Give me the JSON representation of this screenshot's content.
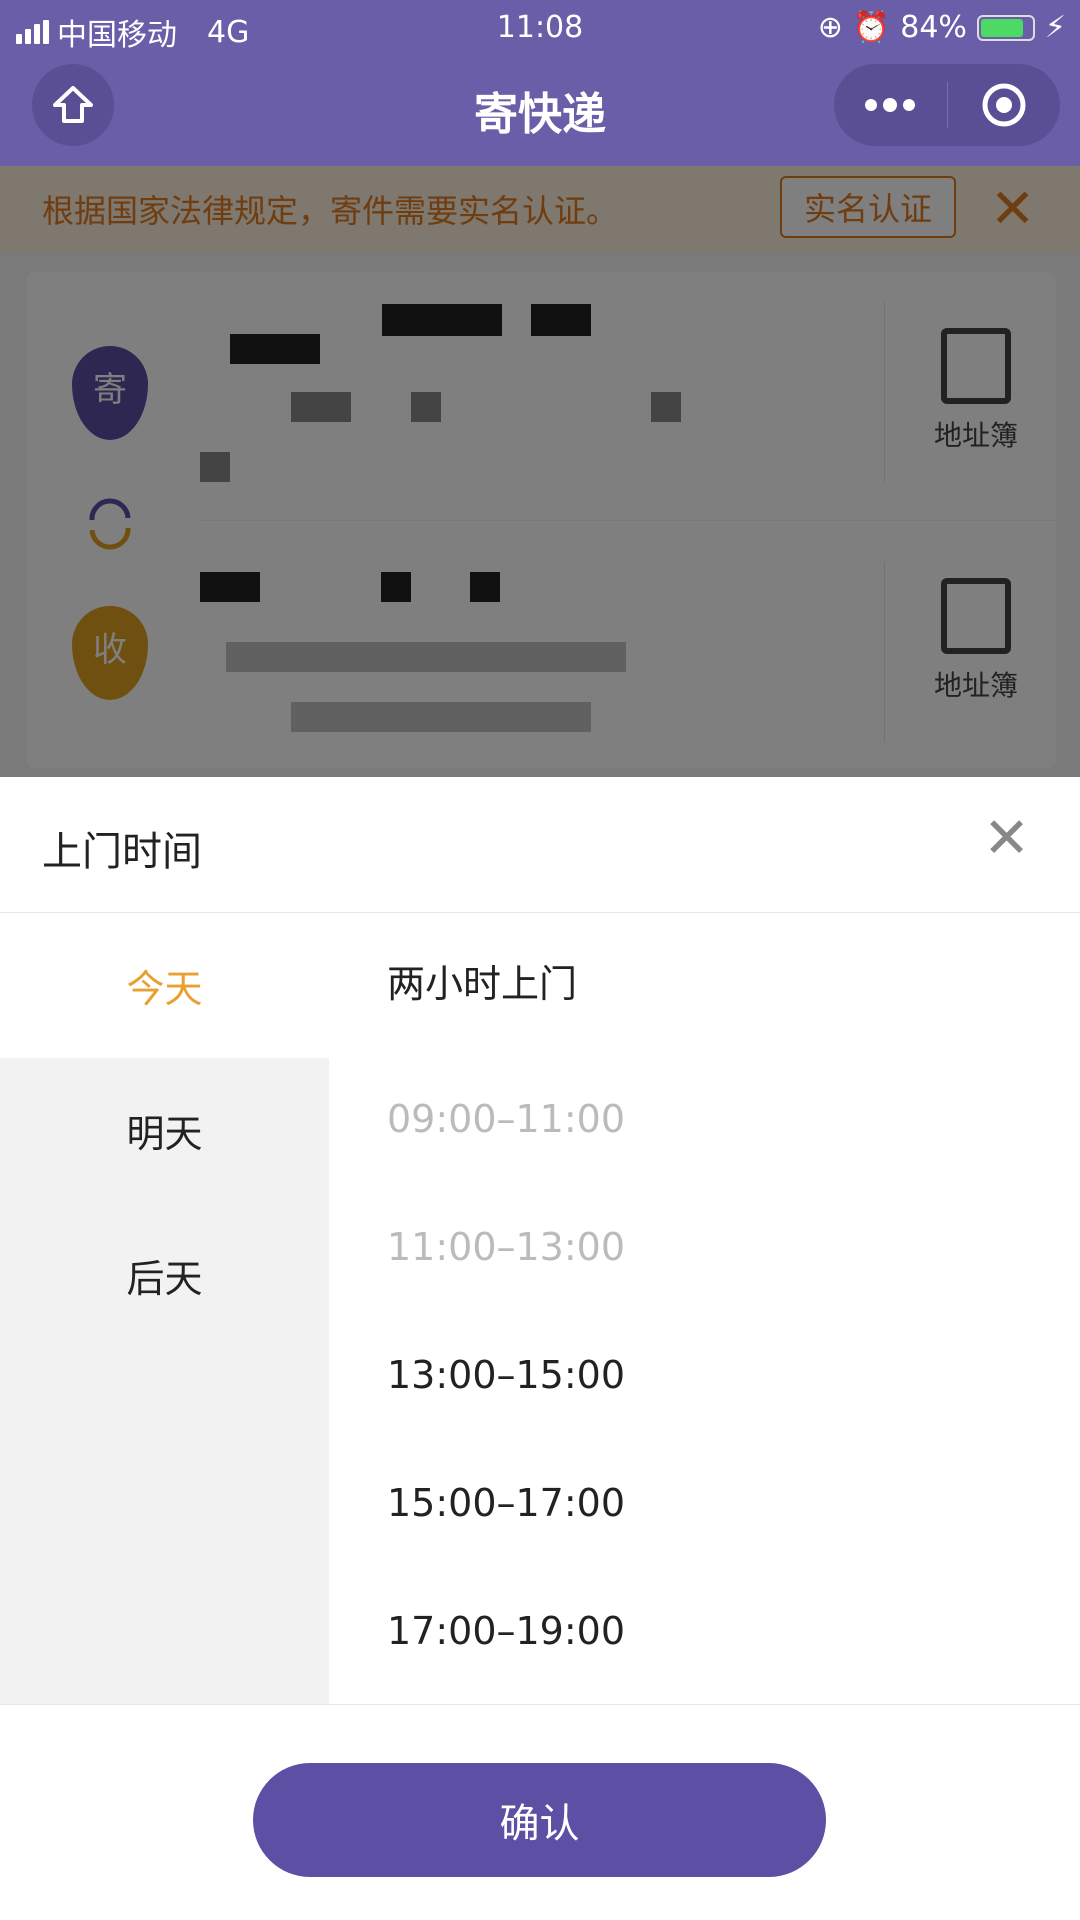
{
  "status_bar": {
    "carrier": "中国移动",
    "network": "4G",
    "time": "11:08",
    "battery": "84%",
    "battery_level": 0.84
  },
  "nav": {
    "title": "寄快递",
    "home_icon": "home-icon",
    "more_icon": "more-dots-icon",
    "close_icon": "target-circle-icon",
    "color": "#6b5ea8"
  },
  "notice": {
    "text": "根据国家法律规定，寄件需要实名认证。",
    "button": "实名认证",
    "close": "✕",
    "color": "#e07a20"
  },
  "address_card": {
    "sender_badge": "寄",
    "receiver_badge": "收",
    "address_book": "地址簿",
    "sender_color": "#5d4fa3",
    "receiver_color": "#e0a020"
  },
  "sheet": {
    "title": "上门时间",
    "close": "✕",
    "days": [
      {
        "label": "今天",
        "selected": true
      },
      {
        "label": "明天"
      },
      {
        "label": "后天"
      }
    ],
    "slots": [
      {
        "label": "两小时上门",
        "disabled": false
      },
      {
        "label": "09:00–11:00",
        "disabled": true
      },
      {
        "label": "11:00–13:00",
        "disabled": true
      },
      {
        "label": "13:00–15:00",
        "disabled": false
      },
      {
        "label": "15:00–17:00",
        "disabled": false
      },
      {
        "label": "17:00–19:00",
        "disabled": false
      }
    ],
    "confirm": "确认",
    "accent": "#e8a030",
    "button_color": "#5d4fa3"
  }
}
